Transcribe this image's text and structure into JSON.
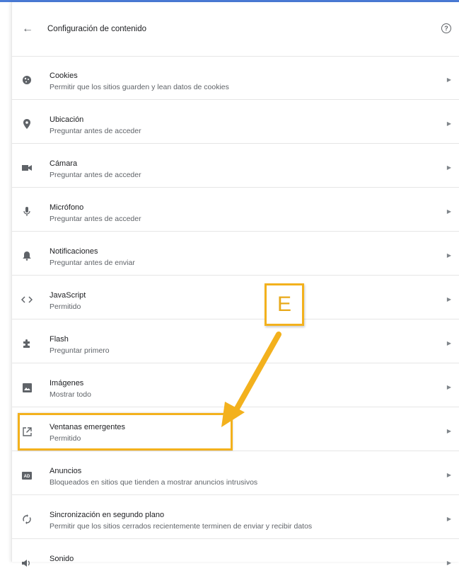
{
  "header": {
    "title": "Configuración de contenido",
    "back_icon": "arrow-left-icon",
    "help_icon": "help-circle-icon",
    "help_glyph": "?"
  },
  "items": [
    {
      "label": "Cookies",
      "sub": "Permitir que los sitios guarden y lean datos de cookies",
      "icon": "cookie-icon"
    },
    {
      "label": "Ubicación",
      "sub": "Preguntar antes de acceder",
      "icon": "location-pin-icon"
    },
    {
      "label": "Cámara",
      "sub": "Preguntar antes de acceder",
      "icon": "camera-icon"
    },
    {
      "label": "Micrófono",
      "sub": "Preguntar antes de acceder",
      "icon": "microphone-icon"
    },
    {
      "label": "Notificaciones",
      "sub": "Preguntar antes de enviar",
      "icon": "bell-icon"
    },
    {
      "label": "JavaScript",
      "sub": "Permitido",
      "icon": "code-icon"
    },
    {
      "label": "Flash",
      "sub": "Preguntar primero",
      "icon": "puzzle-icon"
    },
    {
      "label": "Imágenes",
      "sub": "Mostrar todo",
      "icon": "image-icon"
    },
    {
      "label": "Ventanas emergentes",
      "sub": "Permitido",
      "icon": "open-in-new-icon"
    },
    {
      "label": "Anuncios",
      "sub": "Bloqueados en sitios que tienden a mostrar anuncios intrusivos",
      "icon": "ad-icon"
    },
    {
      "label": "Sincronización en segundo plano",
      "sub": "Permitir que los sitios cerrados recientemente terminen de enviar y recibir datos",
      "icon": "sync-icon"
    },
    {
      "label": "Sonido",
      "sub": "",
      "icon": "volume-icon"
    }
  ],
  "annotation": {
    "callout_letter": "E",
    "color": "#f3b11d"
  }
}
